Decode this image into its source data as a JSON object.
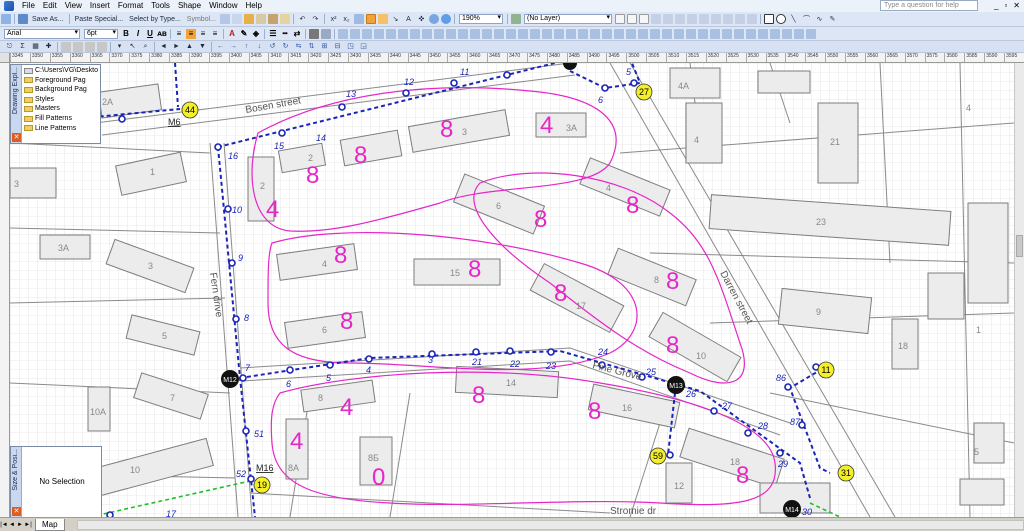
{
  "menu": {
    "items": [
      "File",
      "Edit",
      "View",
      "Insert",
      "Format",
      "Tools",
      "Shape",
      "Window",
      "Help"
    ],
    "help_search_placeholder": "Type a question for help"
  },
  "toolbar": {
    "save_as": "Save As...",
    "paste_special": "Paste Special...",
    "select_by_type": "Select by Type...",
    "symbol": "Symbol...",
    "zoom": "190%",
    "layer": "(No Layer)",
    "font": "Arial",
    "font_size": "6pt"
  },
  "ruler": {
    "h_labels": [
      "3345",
      "3350",
      "3355",
      "3360",
      "3365",
      "3370",
      "3375",
      "3380",
      "3385",
      "3390",
      "3395",
      "3400",
      "3405",
      "3410",
      "3415",
      "3420",
      "3425",
      "3430",
      "3435",
      "3440",
      "3445",
      "3450",
      "3455",
      "3460",
      "3465",
      "3470",
      "3475",
      "3480",
      "3485",
      "3490",
      "3495",
      "3500",
      "3505",
      "3510",
      "3515",
      "3520",
      "3525",
      "3530",
      "3535",
      "3540",
      "3545",
      "3550",
      "3555",
      "3560",
      "3565",
      "3570",
      "3575",
      "3580",
      "3585",
      "3590",
      "3595"
    ]
  },
  "drawing_explorer": {
    "title": "Drawing Expl...",
    "items": [
      "C:\\Users\\VG\\Deskto",
      "Foreground Pag",
      "Background Pag",
      "Styles",
      "Masters",
      "Fill Patterns",
      "Line Patterns"
    ]
  },
  "size_position": {
    "title": "Size & Posi...",
    "message": "No Selection"
  },
  "page_tabs": [
    "Map"
  ],
  "map": {
    "streets": [
      "Bosen street",
      "Fern drive",
      "Darren street",
      "Pine Grove",
      "Stromie dr"
    ],
    "buildings": [
      "2A",
      "1",
      "3",
      "3A",
      "3",
      "5",
      "7",
      "10A",
      "10",
      "2",
      "4",
      "6",
      "15",
      "17",
      "8",
      "10",
      "14",
      "8",
      "8A",
      "8Б",
      "16",
      "18",
      "12",
      "4A",
      "4",
      "21",
      "23",
      "9",
      "18",
      "5",
      "2",
      "3A",
      "3",
      "4",
      "6",
      "4",
      "1"
    ],
    "route_numbers": [
      "5",
      "6",
      "7",
      "8",
      "9",
      "10",
      "11",
      "12",
      "13",
      "14",
      "15",
      "16",
      "17",
      "21",
      "22",
      "23",
      "24",
      "25",
      "26",
      "27",
      "28",
      "29",
      "30",
      "51",
      "52",
      "86",
      "87",
      "3",
      "4",
      "6",
      "5"
    ],
    "markers_yellow": [
      "44",
      "27",
      "11",
      "31",
      "59",
      "19"
    ],
    "markers_black": [
      "М12",
      "М13",
      "М14"
    ],
    "marker_labels": [
      "М6",
      "М16"
    ],
    "area_labels": [
      "8",
      "4",
      "8",
      "8",
      "4",
      "8",
      "8",
      "8",
      "8",
      "8",
      "8",
      "8",
      "8",
      "4",
      "4",
      "0",
      "8",
      "8",
      "8"
    ]
  },
  "colors": {
    "route": "#1a24b8",
    "route_green": "#1fbf2a",
    "highlight": "#e626c8",
    "building_fill": "#ececec",
    "marker_yellow": "#f4ef28",
    "marker_black": "#111111"
  }
}
